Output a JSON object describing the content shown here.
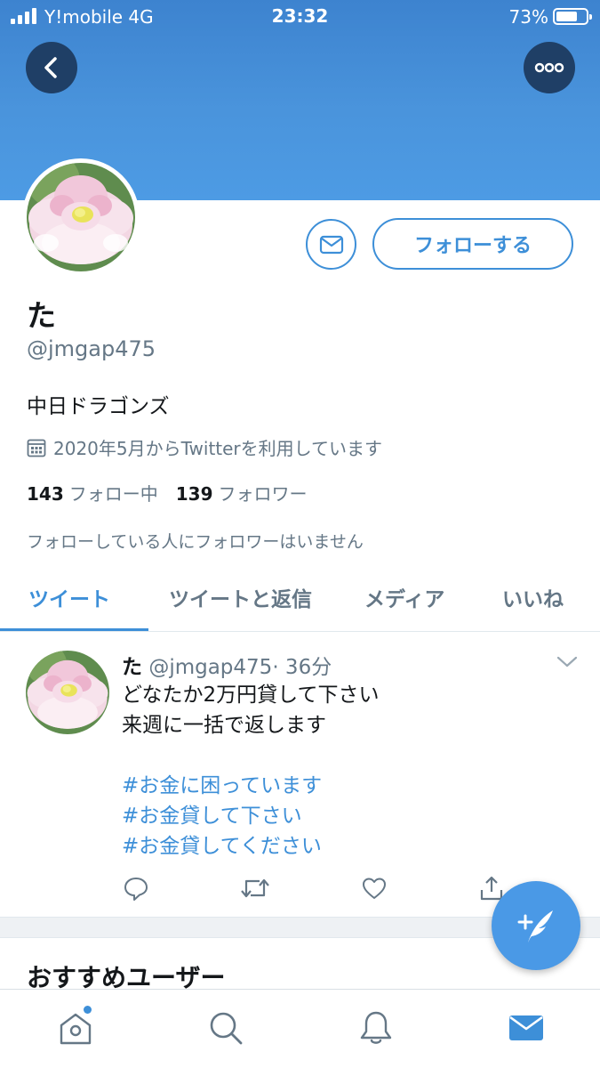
{
  "status_bar": {
    "carrier": "Y!mobile  4G",
    "time": "23:32",
    "battery": "73%",
    "battery_level": 0.73
  },
  "header": {
    "back_icon": "chevron-left-icon",
    "more_icon": "more-horizontal-icon"
  },
  "profile": {
    "display_name": "た",
    "handle": "@jmgap475",
    "bio": "中日ドラゴンズ",
    "joined": "2020年5月からTwitterを利用しています",
    "following_count": "143",
    "following_label": "フォロー中",
    "followers_count": "139",
    "followers_label": "フォロワー",
    "mutual_note": "フォローしている人にフォロワーはいません",
    "follow_button": "フォローする"
  },
  "tabs": [
    {
      "label": "ツイート",
      "active": true
    },
    {
      "label": "ツイートと返信",
      "active": false
    },
    {
      "label": "メディア",
      "active": false
    },
    {
      "label": "いいね",
      "active": false
    }
  ],
  "tweet": {
    "name": "た",
    "handle": "@jmgap475",
    "time": "· 36分",
    "lines": [
      "どなたか2万円貸して下さい",
      "来週に一括で返します"
    ],
    "hashtags": [
      "#お金に困っています",
      "#お金貸して下さい",
      "#お金貸してください"
    ]
  },
  "recommended_title": "おすすめユーザー",
  "colors": {
    "accent": "#3d8fd8",
    "banner": "#4a94dc",
    "muted_text": "#657786"
  }
}
